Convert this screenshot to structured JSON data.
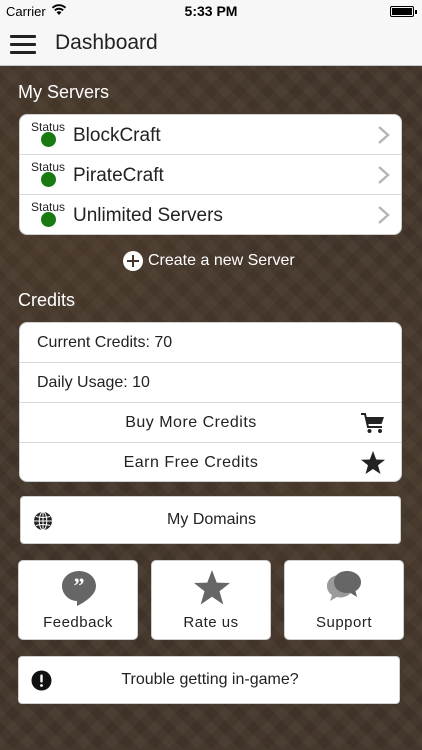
{
  "status_bar": {
    "carrier": "Carrier",
    "time": "5:33 PM"
  },
  "nav": {
    "title": "Dashboard"
  },
  "servers": {
    "title": "My Servers",
    "items": [
      {
        "status_label": "Status",
        "name": "BlockCraft",
        "status_color": "#1a7a12"
      },
      {
        "status_label": "Status",
        "name": "PirateCraft",
        "status_color": "#1a7a12"
      },
      {
        "status_label": "Status",
        "name": "Unlimited Servers",
        "status_color": "#1a7a12"
      }
    ],
    "create_label": "Create a new Server"
  },
  "credits": {
    "title": "Credits",
    "current": "Current Credits: 70",
    "daily": "Daily Usage: 10",
    "buy_label": "Buy More Credits",
    "earn_label": "Earn Free Credits"
  },
  "domains": {
    "label": "My Domains"
  },
  "tiles": {
    "feedback": "Feedback",
    "rate": "Rate us",
    "support": "Support"
  },
  "trouble": {
    "label": "Trouble getting in-game?"
  },
  "colors": {
    "status_green": "#1a7a12",
    "background_brown": "#43352a",
    "icon_gray": "#666666"
  }
}
